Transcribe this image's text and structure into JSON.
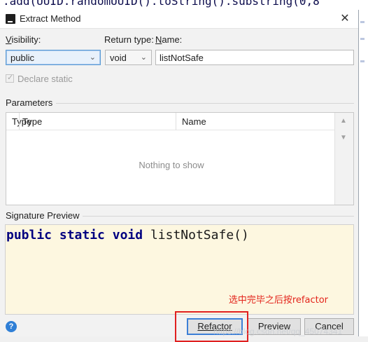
{
  "background_code": ".add(UUID.randomUUID().toString().substring(0,8",
  "dialog": {
    "title": "Extract Method",
    "close_icon": "close-icon"
  },
  "form": {
    "visibility_label": "Visibility:",
    "visibility_value": "public",
    "return_type_label": "Return type:",
    "return_type_value": "void",
    "name_label": "Name:",
    "name_value": "listNotSafe",
    "declare_static_label": "Declare static",
    "declare_static_checked": true,
    "declare_static_enabled": false
  },
  "parameters": {
    "section_label": "Parameters",
    "columns": [
      "Type",
      "Name"
    ],
    "empty_text": "Nothing to show",
    "move_up_icon": "triangle-up-icon",
    "move_down_icon": "triangle-down-icon"
  },
  "signature": {
    "section_label": "Signature Preview",
    "kw1": "public",
    "kw2": "static",
    "kw3": "void",
    "method": "listNotSafe()"
  },
  "annotation": "选中完毕之后按refactor",
  "footer": {
    "help_icon": "help-icon",
    "refactor_label": "Refactor",
    "preview_label": "Preview",
    "cancel_label": "Cancel"
  },
  "watermark": "https://blog.csdn.net/qq_45074341",
  "colors": {
    "annotation": "#e3241b",
    "keyword": "#000080",
    "signature_bg": "#fdf7e0",
    "focus": "#5b9bd5"
  }
}
